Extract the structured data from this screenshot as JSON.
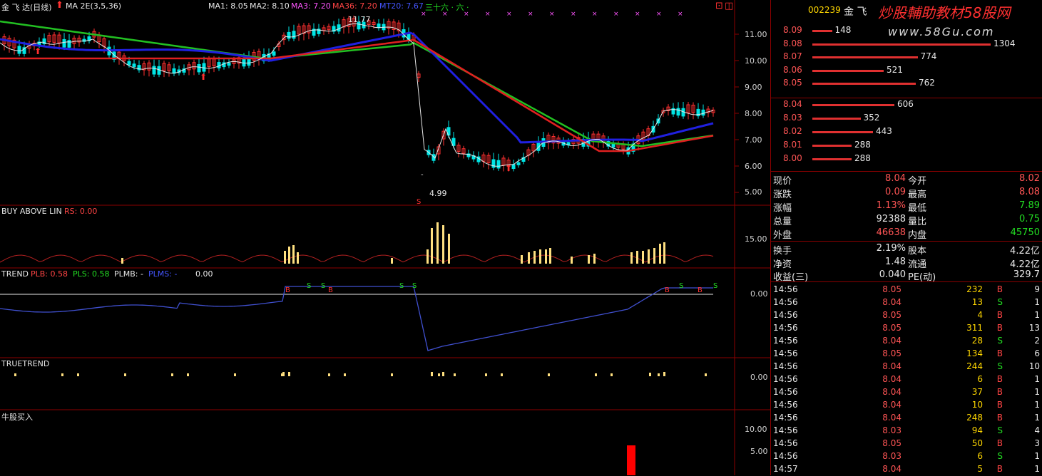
{
  "main": {
    "stock_title": "金 飞 达(日线)",
    "ma_legend": "MA 2E(3,5,36)",
    "ma1": "MA1: 8.05",
    "ma2": "MA2: 8.10",
    "ma3": "MA3: 7.20",
    "ma36": "MA36: 7.20",
    "mt": "MT20: 7.67",
    "extra": "三十六 · 六 ·",
    "high_mark": "11.77",
    "low_mark": "4.99",
    "price_ticks": [
      "11.00",
      "10.00",
      "9.00",
      "8.00",
      "7.00",
      "6.00",
      "5.00"
    ]
  },
  "panels": {
    "buy_above": {
      "title": "BUY ABOVE LIN",
      "rs": "RS: 0.00",
      "tick": "15.00"
    },
    "trend": {
      "title": "TREND",
      "plb": "PLB: 0.58",
      "pls": "PLS: 0.58",
      "plmb": "PLMB: -",
      "plms": "PLMS: -",
      "val": "0.00",
      "tick": "0.00"
    },
    "truetrend": {
      "title": "TRUETREND",
      "tick": "0.00"
    },
    "buy_stock": {
      "title": "牛股买入",
      "ticks": [
        "10.00",
        "5.00"
      ]
    }
  },
  "quote": {
    "code": "002239",
    "name": "金 飞",
    "watermark_cn": "炒股輔助教材58股网",
    "watermark_url": "www.58Gu.com",
    "sell": [
      {
        "price": "8.09",
        "vol": "148",
        "pct": 0.11
      },
      {
        "price": "8.08",
        "vol": "1304",
        "pct": 1.0
      },
      {
        "price": "8.07",
        "vol": "774",
        "pct": 0.59
      },
      {
        "price": "8.06",
        "vol": "521",
        "pct": 0.4
      },
      {
        "price": "8.05",
        "vol": "762",
        "pct": 0.58
      }
    ],
    "buy": [
      {
        "price": "8.04",
        "vol": "606",
        "pct": 0.46
      },
      {
        "price": "8.03",
        "vol": "352",
        "pct": 0.27
      },
      {
        "price": "8.02",
        "vol": "443",
        "pct": 0.34
      },
      {
        "price": "8.01",
        "vol": "288",
        "pct": 0.22
      },
      {
        "price": "8.00",
        "vol": "288",
        "pct": 0.22
      }
    ],
    "stats": [
      {
        "l1": "现价",
        "v1": "8.04",
        "c1": "#ff5555",
        "l2": "今开",
        "v2": "8.02",
        "c2": "#ff5555"
      },
      {
        "l1": "涨跌",
        "v1": "0.09",
        "c1": "#ff5555",
        "l2": "最高",
        "v2": "8.08",
        "c2": "#ff5555"
      },
      {
        "l1": "涨幅",
        "v1": "1.13%",
        "c1": "#ff5555",
        "l2": "最低",
        "v2": "7.89",
        "c2": "#22dd22"
      },
      {
        "l1": "总量",
        "v1": "92388",
        "c1": "#e8e8e8",
        "l2": "量比",
        "v2": "0.75",
        "c2": "#22dd22"
      },
      {
        "l1": "外盘",
        "v1": "46638",
        "c1": "#ff5555",
        "l2": "内盘",
        "v2": "45750",
        "c2": "#22dd22"
      }
    ],
    "stats2": [
      {
        "l1": "换手",
        "v1": "2.19%",
        "l2": "股本",
        "v2": "4.22亿"
      },
      {
        "l1": "净资",
        "v1": "1.48",
        "l2": "流通",
        "v2": "4.22亿"
      },
      {
        "l1": "收益(三)",
        "v1": "0.040",
        "l2": "PE(动)",
        "v2": "329.7"
      }
    ],
    "ticks": [
      {
        "t": "14:56",
        "p": "8.05",
        "v": "232",
        "bs": "B",
        "n": "9"
      },
      {
        "t": "14:56",
        "p": "8.04",
        "v": "13",
        "bs": "S",
        "n": "1"
      },
      {
        "t": "14:56",
        "p": "8.05",
        "v": "4",
        "bs": "B",
        "n": "1"
      },
      {
        "t": "14:56",
        "p": "8.05",
        "v": "311",
        "bs": "B",
        "n": "13"
      },
      {
        "t": "14:56",
        "p": "8.04",
        "v": "28",
        "bs": "S",
        "n": "2"
      },
      {
        "t": "14:56",
        "p": "8.05",
        "v": "134",
        "bs": "B",
        "n": "6"
      },
      {
        "t": "14:56",
        "p": "8.04",
        "v": "244",
        "bs": "S",
        "n": "10"
      },
      {
        "t": "14:56",
        "p": "8.04",
        "v": "6",
        "bs": "B",
        "n": "1"
      },
      {
        "t": "14:56",
        "p": "8.04",
        "v": "37",
        "bs": "B",
        "n": "1"
      },
      {
        "t": "14:56",
        "p": "8.04",
        "v": "10",
        "bs": "B",
        "n": "1"
      },
      {
        "t": "14:56",
        "p": "8.04",
        "v": "248",
        "bs": "B",
        "n": "1"
      },
      {
        "t": "14:56",
        "p": "8.03",
        "v": "94",
        "bs": "S",
        "n": "4"
      },
      {
        "t": "14:56",
        "p": "8.05",
        "v": "50",
        "bs": "B",
        "n": "3"
      },
      {
        "t": "14:56",
        "p": "8.03",
        "v": "6",
        "bs": "S",
        "n": "1"
      },
      {
        "t": "14:57",
        "p": "8.04",
        "v": "5",
        "bs": "B",
        "n": "1"
      }
    ]
  }
}
